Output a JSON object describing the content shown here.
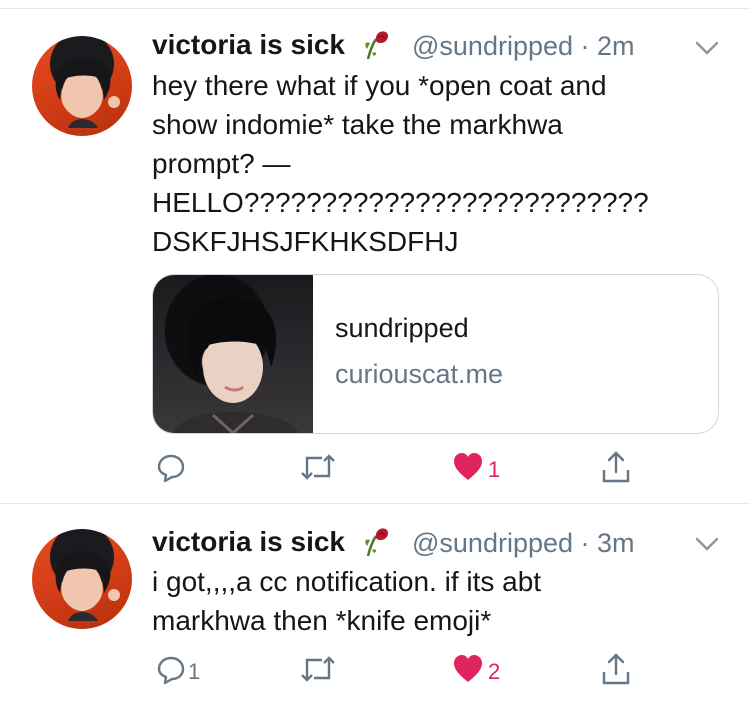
{
  "tweets": [
    {
      "name": "victoria is sick",
      "handle": "@sundripped",
      "time": "· 2m",
      "lines": [
        "hey there what if you *open coat and",
        "show indomie* take the markhwa",
        "prompt? —",
        "HELLO??????????????????????????",
        "DSKFJHSJFKHKSDFHJ"
      ],
      "card": {
        "title": "sundripped",
        "domain": "curiouscat.me"
      },
      "actions": {
        "reply": "",
        "retweet": "",
        "like": "1"
      }
    },
    {
      "name": "victoria is sick",
      "handle": "@sundripped",
      "time": "· 3m",
      "lines": [
        "i got,,,,a cc notification. if its abt",
        "markhwa then *knife emoji*"
      ],
      "actions": {
        "reply": "1",
        "retweet": "",
        "like": "2"
      }
    }
  ],
  "colors": {
    "like": "#e0245e",
    "icon": "#657786",
    "divider": "#e1e8ed"
  }
}
